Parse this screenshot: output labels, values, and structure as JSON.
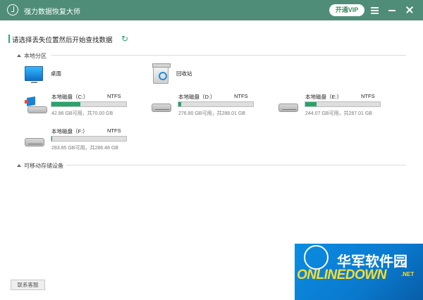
{
  "app": {
    "title": "强力数据恢复大师",
    "vip": "开通VIP"
  },
  "window": {
    "menu_icon": "menu-icon",
    "minimize_icon": "minimize-icon",
    "close_icon": "close-icon"
  },
  "main": {
    "header": "请选择丢失位置然后开始查找数据",
    "refresh_icon": "refresh-icon",
    "local_section": "本地分区",
    "removable_section": "可移动存储设备",
    "desktop": "桌面",
    "recycle_bin": "回收站"
  },
  "drives": [
    {
      "label": "本地磁盘（C:）",
      "fs": "NTFS",
      "size": "42.86 GB可用，共70.00 GB",
      "used_fraction": 0.39
    },
    {
      "label": "本地磁盘（D:）",
      "fs": "NTFS",
      "size": "276.80 GB可用，共288.01 GB",
      "used_fraction": 0.04
    },
    {
      "label": "本地磁盘（E:）",
      "fs": "NTFS",
      "size": "244.07 GB可用，共287.01 GB",
      "used_fraction": 0.15
    },
    {
      "label": "本地磁盘（F:）",
      "fs": "NTFS",
      "size": "283.85 GB可用，共286.48 GB",
      "used_fraction": 0.01
    }
  ],
  "footer": {
    "support": "联系客服"
  },
  "watermark": {
    "cn": "华军软件园",
    "en_main": "ONLINEDOWN",
    "en_suffix": ".NET"
  },
  "colors": {
    "accent": "#4f8d78",
    "progress": "#27a36c"
  }
}
